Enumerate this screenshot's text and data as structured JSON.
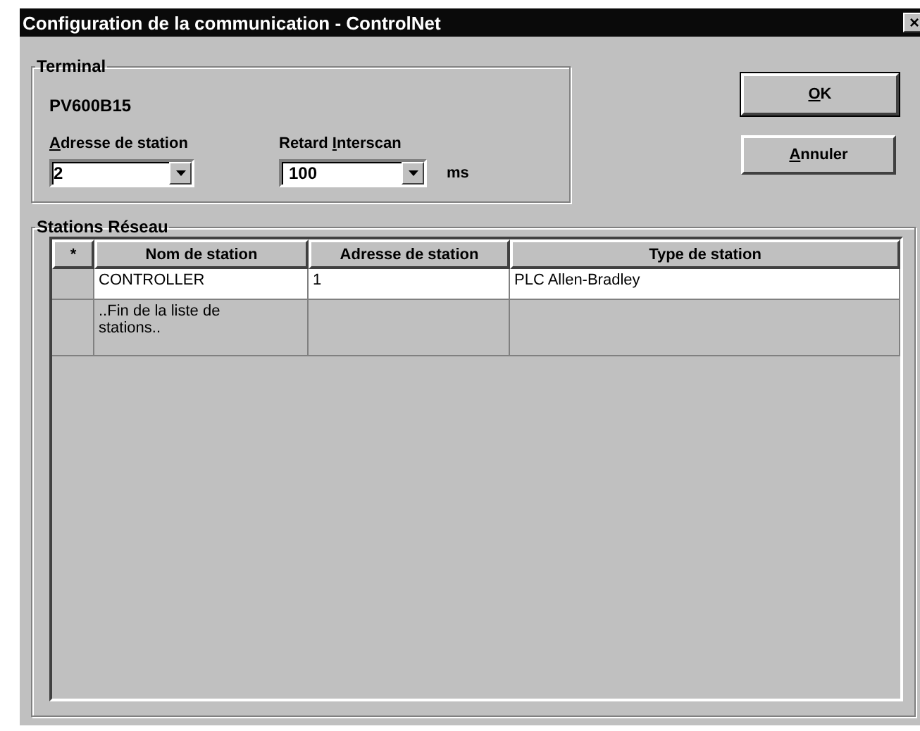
{
  "window": {
    "title": "Configuration de la communication - ControlNet",
    "close": "×"
  },
  "terminal": {
    "title": "Terminal",
    "name": "PV600B15",
    "station_address": {
      "label": [
        {
          "text": "A",
          "underlined": true
        },
        {
          "text": "dresse de station",
          "underlined": false
        }
      ],
      "value": "2"
    },
    "interscan_delay": {
      "label": [
        {
          "text": "Retard ",
          "underlined": false
        },
        {
          "text": "I",
          "underlined": true
        },
        {
          "text": "nterscan",
          "underlined": false
        }
      ],
      "value": "100",
      "unit": "ms"
    }
  },
  "buttons": [
    {
      "label": [
        {
          "text": "O",
          "underlined": true
        },
        {
          "text": "K",
          "underlined": false
        }
      ],
      "default": true
    },
    {
      "label": [
        {
          "text": "A",
          "underlined": true
        },
        {
          "text": "nnuler",
          "underlined": false
        }
      ],
      "default": false
    }
  ],
  "stations": {
    "title": "Stations Réseau",
    "columns": [
      "*",
      "Nom de station",
      "Adresse de station",
      "Type de station"
    ],
    "rows": [
      {
        "kind": "station",
        "cells": [
          "",
          "CONTROLLER",
          "1",
          "PLC Allen-Bradley"
        ]
      },
      {
        "kind": "end",
        "cells": [
          "",
          "..Fin de la liste de stations..",
          "",
          ""
        ]
      }
    ]
  }
}
